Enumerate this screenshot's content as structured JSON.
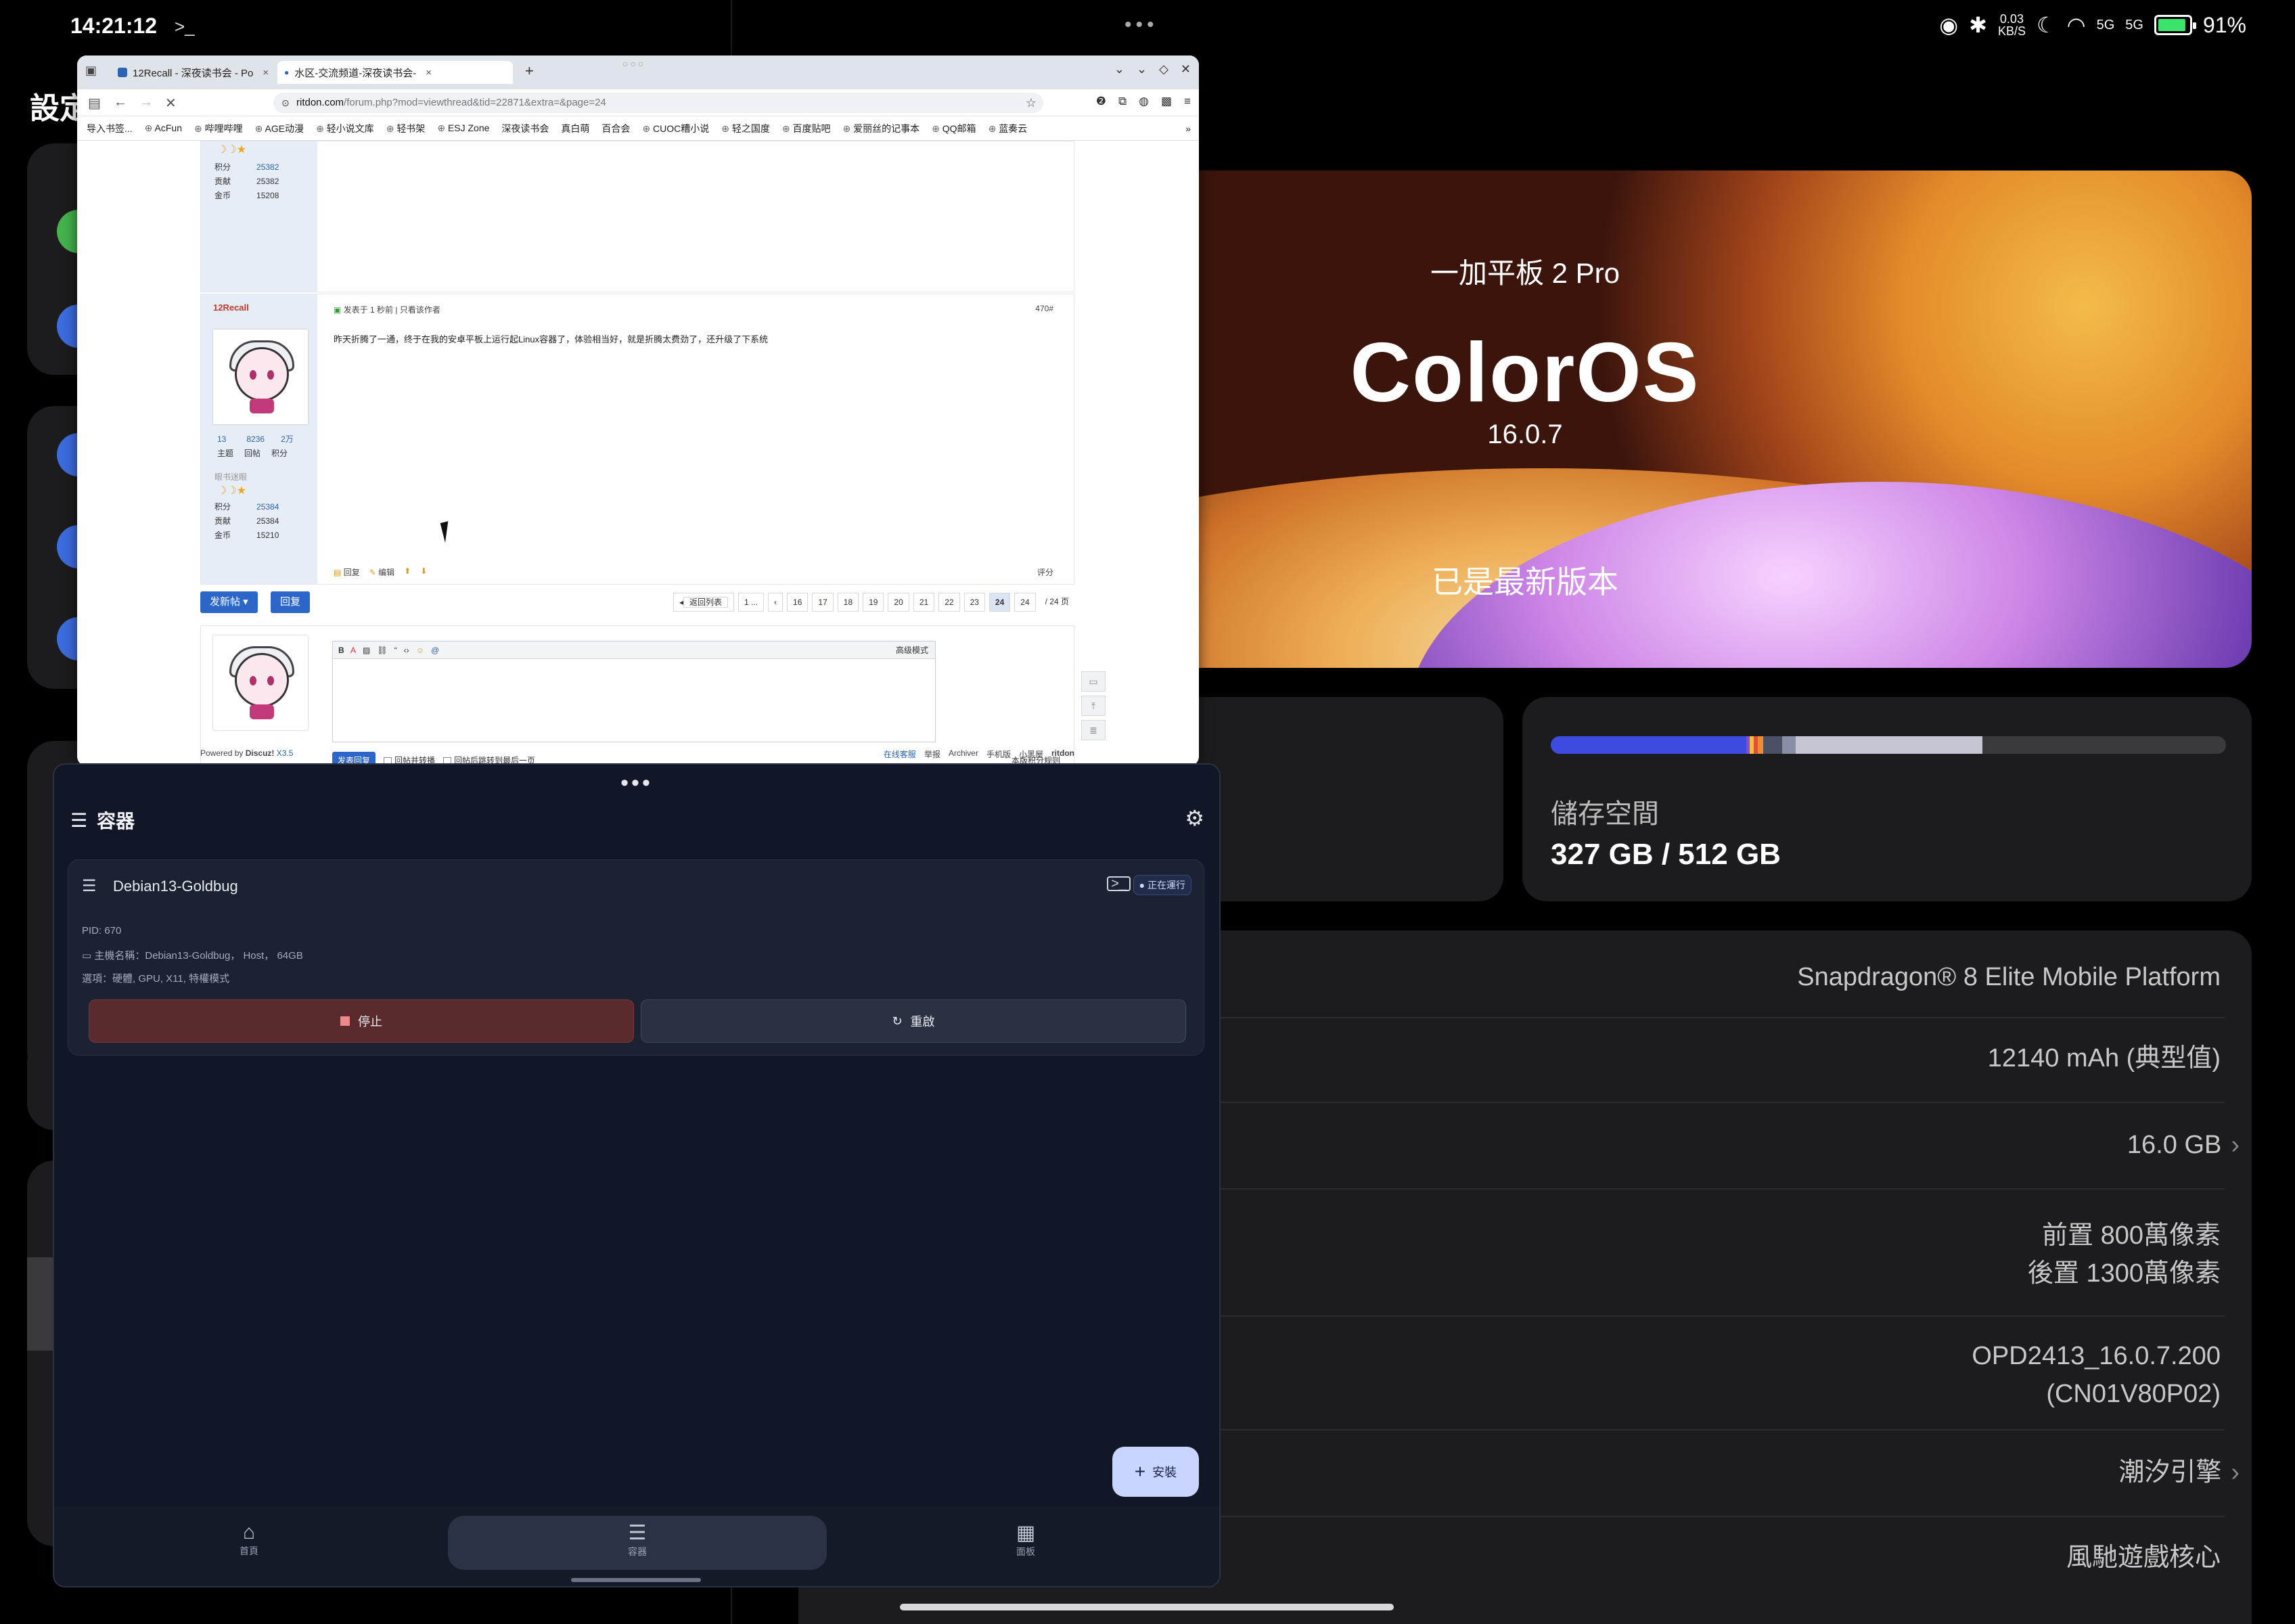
{
  "status": {
    "time": "14:21:12",
    "network_speed": "0.03",
    "network_unit": "KB/S",
    "sig1": "5G",
    "sig2": "5G",
    "battery": "91%"
  },
  "left_pane": {
    "title": "設定"
  },
  "about": {
    "device_model": "一加平板 2 Pro",
    "os_name": "ColorOS",
    "os_version": "16.0.7",
    "update_status": "已是最新版本",
    "storage_label": "儲存空間",
    "storage_value": "327 GB / 512 GB",
    "storage_used_fraction": 0.639,
    "specs": [
      {
        "value": "Snapdragon® 8 Elite Mobile Platform"
      },
      {
        "value": "12140 mAh (典型值)"
      },
      {
        "value": "16.0 GB",
        "chevron": "›"
      },
      {
        "value": "前置 800萬像素",
        "value2": "後置 1300萬像素"
      },
      {
        "value": "OPD2413_16.0.7.200",
        "value2": "(CN01V80P02)"
      },
      {
        "value": "潮汐引擎",
        "chevron": "›"
      },
      {
        "value": "風馳遊戲核心"
      }
    ]
  },
  "browser": {
    "tabs": [
      {
        "title": "12Recall - 深夜读书会 - Po"
      },
      {
        "title": "水区-交流频道-深夜读书会-"
      }
    ],
    "url_host": "ritdon.com",
    "url_path": "/forum.php?mod=viewthread&tid=22871&extra=&page=24",
    "bookmarks": [
      "导入书签...",
      "AcFun",
      "哔哩哔哩",
      "AGE动漫",
      "轻小说文库",
      "轻书架",
      "ESJ Zone",
      "深夜读书会",
      "真白萌",
      "百合会",
      "CUOC糟小说",
      "轻之国度",
      "百度贴吧",
      "爱丽丝的记事本",
      "QQ邮箱",
      "蓝奏云"
    ],
    "post1": {
      "stats": [
        {
          "k": "积分",
          "v": "25382"
        },
        {
          "k": "贡献",
          "v": "25382"
        },
        {
          "k": "金币",
          "v": "15208"
        }
      ]
    },
    "post2": {
      "username": "12Recall",
      "meta": "发表于 1 秒前",
      "only_author": "只看该作者",
      "floor": "470#",
      "content": "昨天折腾了一通，终于在我的安卓平板上运行起Linux容器了，体验相当好，就是折腾太费劲了，还升级了下系统",
      "counts": [
        "13",
        "8236",
        "2万"
      ],
      "count_labels": [
        "主题",
        "回帖",
        "积分"
      ],
      "rank": "眼书迷眼",
      "stats": [
        {
          "k": "积分",
          "v": "25384"
        },
        {
          "k": "贡献",
          "v": "25384"
        },
        {
          "k": "金币",
          "v": "15210"
        }
      ],
      "actions": [
        "回复",
        "编辑"
      ],
      "rate": "评分"
    },
    "new_post": "发新帖",
    "reply": "回复",
    "pages": [
      "返回列表",
      "1 ...",
      "‹",
      "16",
      "17",
      "18",
      "19",
      "20",
      "21",
      "22",
      "23",
      "24",
      "24",
      "/ 24 页"
    ],
    "current_page": "24",
    "editor_advanced": "高级模式",
    "send_reply": "发表回复",
    "opt1": "回帖并转播",
    "opt2": "回帖后跳转到最后一页",
    "rules": "本版积分规则",
    "powered_prefix": "Powered by",
    "powered_name": "Discuz!",
    "powered_ver": "X3.5",
    "footer_links": [
      "在线客服",
      "举报",
      "Archiver",
      "手机版",
      "小黑屋",
      "ritdon"
    ]
  },
  "app": {
    "title": "容器",
    "container_name": "Debian13-Goldbug",
    "running": "正在運行",
    "pid": "PID: 670",
    "host_line": "主機名稱：Debian13-Goldbug， Host， 64GB",
    "options_line": "選項：硬體, GPU, X11, 特權模式",
    "stop": "停止",
    "restart": "重啟",
    "install": "安裝",
    "nav": [
      {
        "label": "首頁",
        "icon": "home-icon"
      },
      {
        "label": "容器",
        "icon": "list-icon"
      },
      {
        "label": "面板",
        "icon": "grid-icon"
      }
    ]
  },
  "colors": {
    "accent_blue": "#2d66c9",
    "stop_red": "#5a2a2c",
    "fab": "#c9d4ff"
  }
}
